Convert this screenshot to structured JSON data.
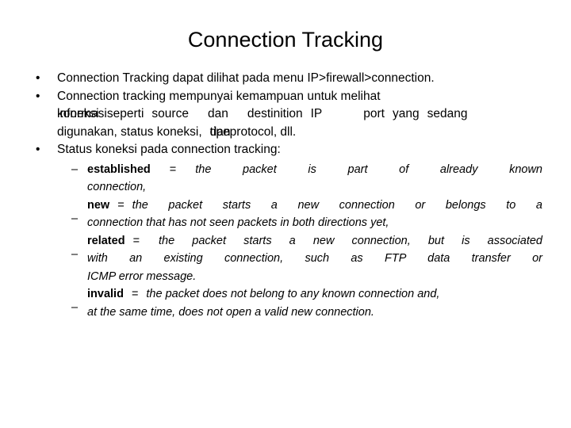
{
  "slide": {
    "title": "Connection Tracking",
    "bullet_marker": "•",
    "dash_marker": "–",
    "bullets": [
      {
        "id": "bullet-1",
        "text": "Connection Tracking dapat dilihat pada menu IP>firewall>connection."
      },
      {
        "id": "bullet-2",
        "line1": "Connection tracking mempunyai kemampuan untuk melihat",
        "line2_overlap_a": "koneksi",
        "line2_overlap_b": "informasi",
        "line2_rest_a": "seperti",
        "line2_rest_b": "source",
        "line2_rest_c": "dan",
        "line2_rest_d": "destinition",
        "line2_rest_e": "IP",
        "line2_rest_f": "port",
        "line2_rest_g": "yang",
        "line2_rest_h": "sedang",
        "line3_a": "digunakan, status koneksi,",
        "line3_overlap_a": "dan",
        "line3_overlap_b": "tipe",
        "line3_b": "protocol, dll."
      },
      {
        "id": "bullet-3",
        "text": "Status koneksi pada connection tracking:"
      }
    ],
    "states": [
      {
        "id": "state-established",
        "term": "established",
        "equals": "=",
        "definition_line1": "the    packet    is    part    of    already    known",
        "definition_line2": "connection,"
      },
      {
        "id": "state-new",
        "term": "new",
        "equals": "=",
        "definition_line1": "the  packet  starts  a  new  connection  or  belongs  to  a",
        "definition_line2": "connection that has not seen packets in both directions yet,"
      },
      {
        "id": "state-related",
        "term": "related",
        "equals": "=",
        "definition_line1": "the  packet  starts  a  new  connection,  but  is  associated",
        "definition_line2": "with an  existing  connection,  such  as  FTP  data  transfer  or",
        "definition_line3": "ICMP  error message."
      },
      {
        "id": "state-invalid",
        "term": "invalid",
        "equals": "=",
        "definition_line1": "the packet does not belong to any known connection and,",
        "definition_line2": "at the same time, does not open a valid new connection."
      }
    ]
  }
}
